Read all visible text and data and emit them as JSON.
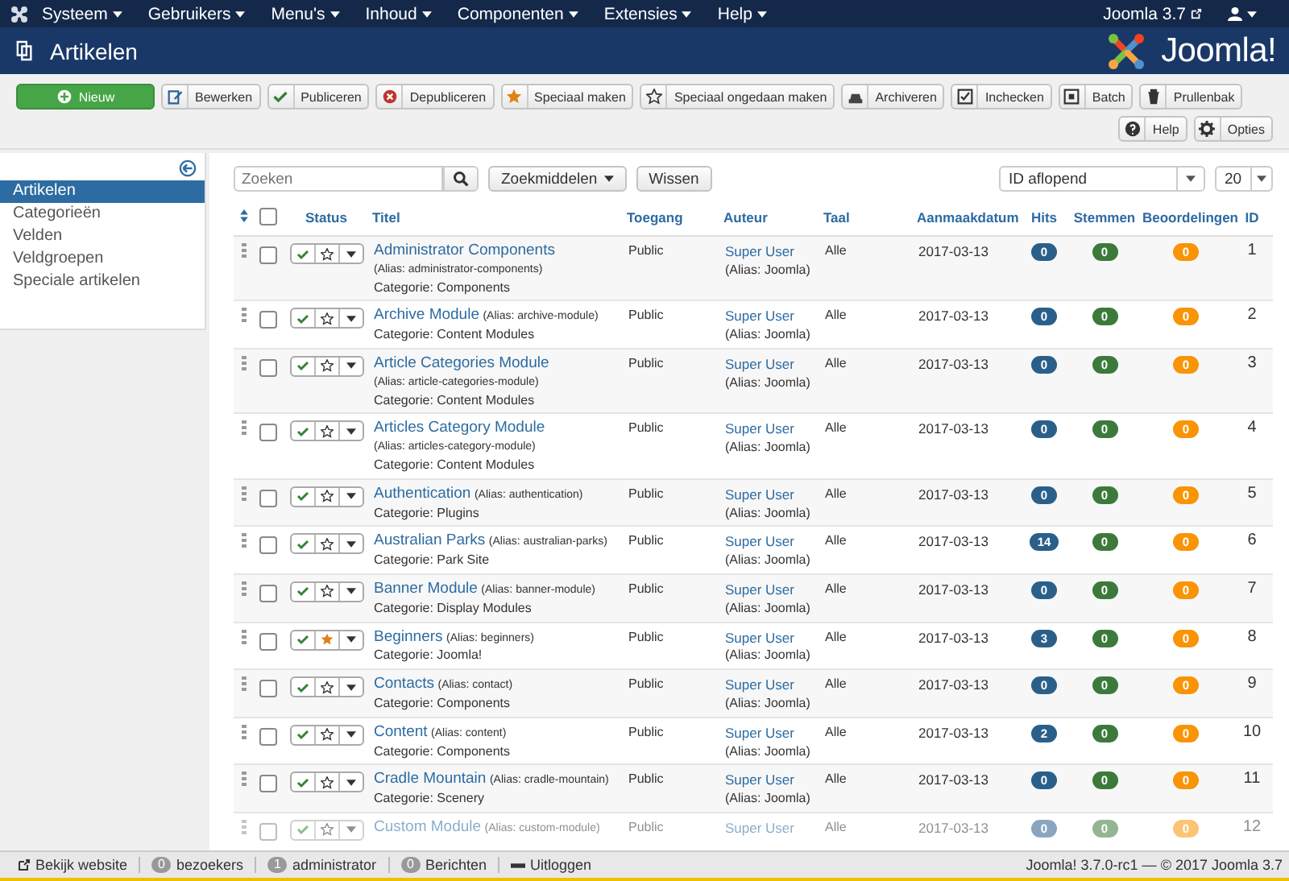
{
  "navbar": {
    "menus": [
      "Systeem",
      "Gebruikers",
      "Menu's",
      "Inhoud",
      "Componenten",
      "Extensies",
      "Help"
    ],
    "site_link": "Joomla 3.7"
  },
  "header": {
    "title": "Artikelen",
    "logo": "Joomla!"
  },
  "toolbar": {
    "buttons": [
      {
        "label": "Nieuw",
        "kind": "primary"
      },
      {
        "label": "Bewerken",
        "kind": "default"
      },
      {
        "label": "Publiceren",
        "kind": "default"
      },
      {
        "label": "Depubliceren",
        "kind": "default"
      },
      {
        "label": "Speciaal maken",
        "kind": "default"
      },
      {
        "label": "Speciaal ongedaan maken",
        "kind": "default"
      },
      {
        "label": "Archiveren",
        "kind": "default"
      },
      {
        "label": "Inchecken",
        "kind": "default"
      },
      {
        "label": "Batch",
        "kind": "default"
      },
      {
        "label": "Prullenbak",
        "kind": "default"
      }
    ],
    "secondary_buttons": [
      "Help",
      "Opties"
    ]
  },
  "sidebar": {
    "items": [
      {
        "label": "Artikelen",
        "selected": true
      },
      {
        "label": "Categorieën",
        "selected": false
      },
      {
        "label": "Velden",
        "selected": false
      },
      {
        "label": "Veldgroepen",
        "selected": false
      },
      {
        "label": "Speciale artikelen",
        "selected": false
      }
    ]
  },
  "filters": {
    "search": {
      "placeholder": "Zoeken"
    },
    "tools_button": "Zoekmiddelen",
    "clear_button": "Wissen",
    "ordering": "ID aflopend",
    "limit": "20"
  },
  "table": {
    "select_all_checked": false,
    "columns": [
      "Status",
      "Titel",
      "Toegang",
      "Auteur",
      "Taal",
      "Aanmaakdatum",
      "Hits",
      "Stemmen",
      "Beoordelingen",
      "ID"
    ],
    "rows": [
      {
        "title": "Administrator Components",
        "alias": "(Alias: administrator-components)",
        "category": "Categorie: Components",
        "access": "Public",
        "author": "Super User",
        "author_alias": "(Alias: Joomla)",
        "language": "Alle",
        "date": "2017-03-13",
        "hits": "0",
        "votes": "0",
        "ratings": "0",
        "id": "1",
        "checked": false,
        "published": true,
        "featured": false
      },
      {
        "title": "Archive Module",
        "alias": "(Alias: archive-module)",
        "category": "Categorie: Content Modules",
        "access": "Public",
        "author": "Super User",
        "author_alias": "(Alias: Joomla)",
        "language": "Alle",
        "date": "2017-03-13",
        "hits": "0",
        "votes": "0",
        "ratings": "0",
        "id": "2",
        "checked": false,
        "published": true,
        "featured": false
      },
      {
        "title": "Article Categories Module",
        "alias": "(Alias: article-categories-module)",
        "category": "Categorie: Content Modules",
        "access": "Public",
        "author": "Super User",
        "author_alias": "(Alias: Joomla)",
        "language": "Alle",
        "date": "2017-03-13",
        "hits": "0",
        "votes": "0",
        "ratings": "0",
        "id": "3",
        "checked": false,
        "published": true,
        "featured": false
      },
      {
        "title": "Articles Category Module",
        "alias": "(Alias: articles-category-module)",
        "category": "Categorie: Content Modules",
        "access": "Public",
        "author": "Super User",
        "author_alias": "(Alias: Joomla)",
        "language": "Alle",
        "date": "2017-03-13",
        "hits": "0",
        "votes": "0",
        "ratings": "0",
        "id": "4",
        "checked": false,
        "published": true,
        "featured": false
      },
      {
        "title": "Authentication",
        "alias": "(Alias: authentication)",
        "category": "Categorie: Plugins",
        "access": "Public",
        "author": "Super User",
        "author_alias": "(Alias: Joomla)",
        "language": "Alle",
        "date": "2017-03-13",
        "hits": "0",
        "votes": "0",
        "ratings": "0",
        "id": "5",
        "checked": false,
        "published": true,
        "featured": false
      },
      {
        "title": "Australian Parks",
        "alias": "(Alias: australian-parks)",
        "category": "Categorie: Park Site",
        "access": "Public",
        "author": "Super User",
        "author_alias": "(Alias: Joomla)",
        "language": "Alle",
        "date": "2017-03-13",
        "hits": "14",
        "votes": "0",
        "ratings": "0",
        "id": "6",
        "checked": false,
        "published": true,
        "featured": false
      },
      {
        "title": "Banner Module",
        "alias": "(Alias: banner-module)",
        "category": "Categorie: Display Modules",
        "access": "Public",
        "author": "Super User",
        "author_alias": "(Alias: Joomla)",
        "language": "Alle",
        "date": "2017-03-13",
        "hits": "0",
        "votes": "0",
        "ratings": "0",
        "id": "7",
        "checked": false,
        "published": true,
        "featured": false
      },
      {
        "title": "Beginners",
        "alias": "(Alias: beginners)",
        "category": "Categorie: Joomla!",
        "access": "Public",
        "author": "Super User",
        "author_alias": "(Alias: Joomla)",
        "language": "Alle",
        "date": "2017-03-13",
        "hits": "3",
        "votes": "0",
        "ratings": "0",
        "id": "8",
        "checked": false,
        "published": true,
        "featured": true
      },
      {
        "title": "Contacts",
        "alias": "(Alias: contact)",
        "category": "Categorie: Components",
        "access": "Public",
        "author": "Super User",
        "author_alias": "(Alias: Joomla)",
        "language": "Alle",
        "date": "2017-03-13",
        "hits": "0",
        "votes": "0",
        "ratings": "0",
        "id": "9",
        "checked": false,
        "published": true,
        "featured": false
      },
      {
        "title": "Content",
        "alias": "(Alias: content)",
        "category": "Categorie: Components",
        "access": "Public",
        "author": "Super User",
        "author_alias": "(Alias: Joomla)",
        "language": "Alle",
        "date": "2017-03-13",
        "hits": "2",
        "votes": "0",
        "ratings": "0",
        "id": "10",
        "checked": false,
        "published": true,
        "featured": false
      },
      {
        "title": "Cradle Mountain",
        "alias": "(Alias: cradle-mountain)",
        "category": "Categorie: Scenery",
        "access": "Public",
        "author": "Super User",
        "author_alias": "(Alias: Joomla)",
        "language": "Alle",
        "date": "2017-03-13",
        "hits": "0",
        "votes": "0",
        "ratings": "0",
        "id": "11",
        "checked": false,
        "published": true,
        "featured": false
      },
      {
        "title": "Custom Module",
        "alias": "(Alias: custom-module)",
        "access": "Public",
        "author": "Super User",
        "language": "Alle",
        "date": "2017-03-13",
        "hits": "0",
        "votes": "0",
        "ratings": "0",
        "id": "12",
        "checked": false,
        "published": true,
        "featured": false
      }
    ]
  },
  "status_bar": {
    "view_site": "Bekijk website",
    "items": [
      {
        "count": "0",
        "label": "bezoekers"
      },
      {
        "count": "1",
        "label": "administrator"
      },
      {
        "count": "0",
        "label": "Berichten"
      }
    ],
    "logout": "Uitloggen",
    "version": "Joomla! 3.7.0-rc1 — © 2017 Joomla 3.7"
  }
}
